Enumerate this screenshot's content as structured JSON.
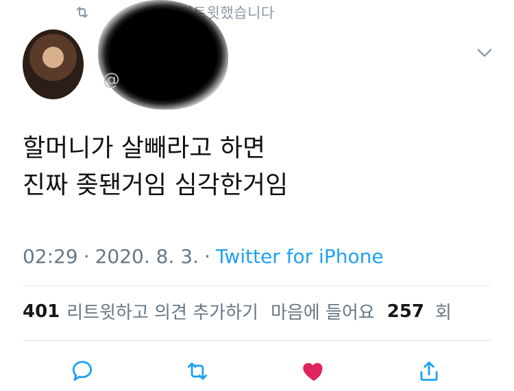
{
  "retweet_context": {
    "text": "리트윗했습니다"
  },
  "author": {
    "handle_visible": "@"
  },
  "tweet": {
    "text": "할머니가 살빼라고 하면\n진짜 좆됀거임 심각한거임"
  },
  "meta": {
    "time": "02:29",
    "separator": "·",
    "date": "2020. 8. 3.",
    "source": "Twitter for iPhone"
  },
  "stats": {
    "retweets": "401",
    "retweets_label": "리트윗하고 의견 추가하기",
    "likes_label": "마음에 들어요",
    "likes": "257",
    "likes_suffix": "회"
  },
  "actions": [
    {
      "name": "reply-icon"
    },
    {
      "name": "retweet-icon"
    },
    {
      "name": "heart-icon",
      "color": "#e0245e"
    },
    {
      "name": "share-icon"
    }
  ],
  "colors": {
    "accent": "#1da1f2",
    "muted": "#657786",
    "divider": "#e1e8ed",
    "like": "#e0245e"
  }
}
